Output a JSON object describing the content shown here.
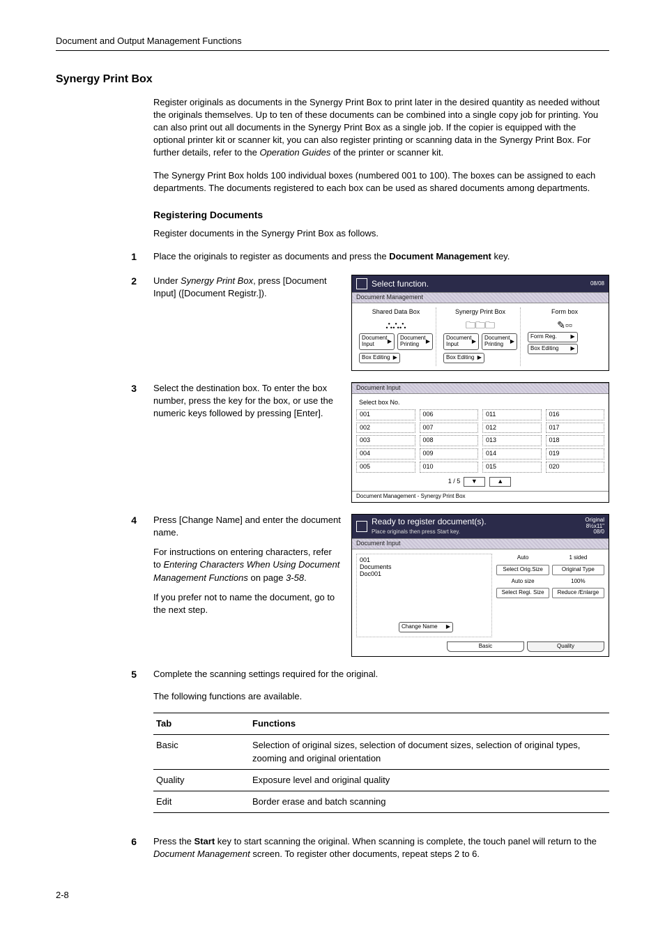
{
  "running_header": "Document and Output Management Functions",
  "h1": "Synergy Print Box",
  "intro_p1": "Register originals as documents in the Synergy Print Box to print later in the desired quantity as needed without the originals themselves. Up to ten of these documents can be combined into a single copy job for printing. You can also print out all documents in the Synergy Print Box as a single job. If the copier is equipped with the optional printer kit or scanner kit, you can also register printing or scanning data in the Synergy Print Box. For further details, refer to the ",
  "intro_p1_em": "Operation Guides",
  "intro_p1_tail": " of the printer or scanner kit.",
  "intro_p2": "The Synergy Print Box holds 100 individual boxes (numbered 001 to 100). The boxes can be assigned to each departments. The documents registered to each box can be used as shared documents among departments.",
  "h2": "Registering Documents",
  "reg_intro": "Register documents in the Synergy Print Box as follows.",
  "steps": {
    "s1": {
      "num": "1",
      "text_a": "Place the originals to register as documents and press the ",
      "bold": "Document Management",
      "text_b": " key."
    },
    "s2": {
      "num": "2",
      "text_a": "Under ",
      "em": "Synergy Print Box",
      "text_b": ", press [Document Input] ([Document Registr.])."
    },
    "s3": {
      "num": "3",
      "text": "Select the destination box. To enter the box number, press the key for the box, or use the numeric keys followed by pressing [Enter]."
    },
    "s4": {
      "num": "4",
      "p1": "Press [Change Name] and enter the document name.",
      "p2_a": "For instructions on entering characters, refer to ",
      "p2_em": "Entering Characters When Using Document Management Functions",
      "p2_b": " on page ",
      "p2_em2": "3-58",
      "p2_c": ".",
      "p3": "If you prefer not to name the document, go to the next step."
    },
    "s5": {
      "num": "5",
      "p1": "Complete the scanning settings required for the original.",
      "p2": "The following functions are available."
    },
    "s6": {
      "num": "6",
      "text_a": "Press the ",
      "bold": "Start",
      "text_b": " key to start scanning the original. When scanning is complete, the touch panel will return to the ",
      "em": "Document Management",
      "text_c": " screen. To register other documents, repeat steps 2 to 6."
    }
  },
  "func_table": {
    "head_tab": "Tab",
    "head_func": "Functions",
    "rows": [
      {
        "tab": "Basic",
        "func": "Selection of original sizes, selection of document sizes, selection of original types, zooming and original orientation"
      },
      {
        "tab": "Quality",
        "func": "Exposure level and original quality"
      },
      {
        "tab": "Edit",
        "func": "Border erase and batch scanning"
      }
    ]
  },
  "screenshot1": {
    "title": "Select function.",
    "clock": "08/08",
    "section": "Document Management",
    "cols": [
      "Shared Data Box",
      "Synergy Print Box",
      "Form box"
    ],
    "btns": {
      "doc_input": "Document Input",
      "doc_print": "Document Printing",
      "box_edit": "Box Editing",
      "form_reg": "Form Reg."
    }
  },
  "screenshot2": {
    "section": "Document Input",
    "subhead": "Select box No.",
    "boxes": [
      "001",
      "006",
      "011",
      "016",
      "002",
      "007",
      "012",
      "017",
      "003",
      "008",
      "013",
      "018",
      "004",
      "009",
      "014",
      "019",
      "005",
      "010",
      "015",
      "020"
    ],
    "pager": "1 / 5",
    "footer": "Document Management    -    Synergy Print Box"
  },
  "screenshot3": {
    "title": "Ready to register document(s).",
    "subtitle": "Place originals then press Start key.",
    "meta_top": "Original",
    "meta_size": "8½x11\"",
    "meta_clock": "08/0",
    "section": "Document Input",
    "left": {
      "box": "001",
      "label": "Documents",
      "name": "Doc001",
      "change": "Change Name"
    },
    "right": {
      "r1a": "Auto",
      "r1b": "1 sided",
      "r2a": "Select Orig.Size",
      "r2b": "Original Type",
      "r3a": "Auto size",
      "r3b": "100%",
      "r4a": "Select Regi. Size",
      "r4b": "Reduce /Enlarge"
    },
    "tabs": [
      "Basic",
      "Quality"
    ]
  },
  "page_number": "2-8"
}
